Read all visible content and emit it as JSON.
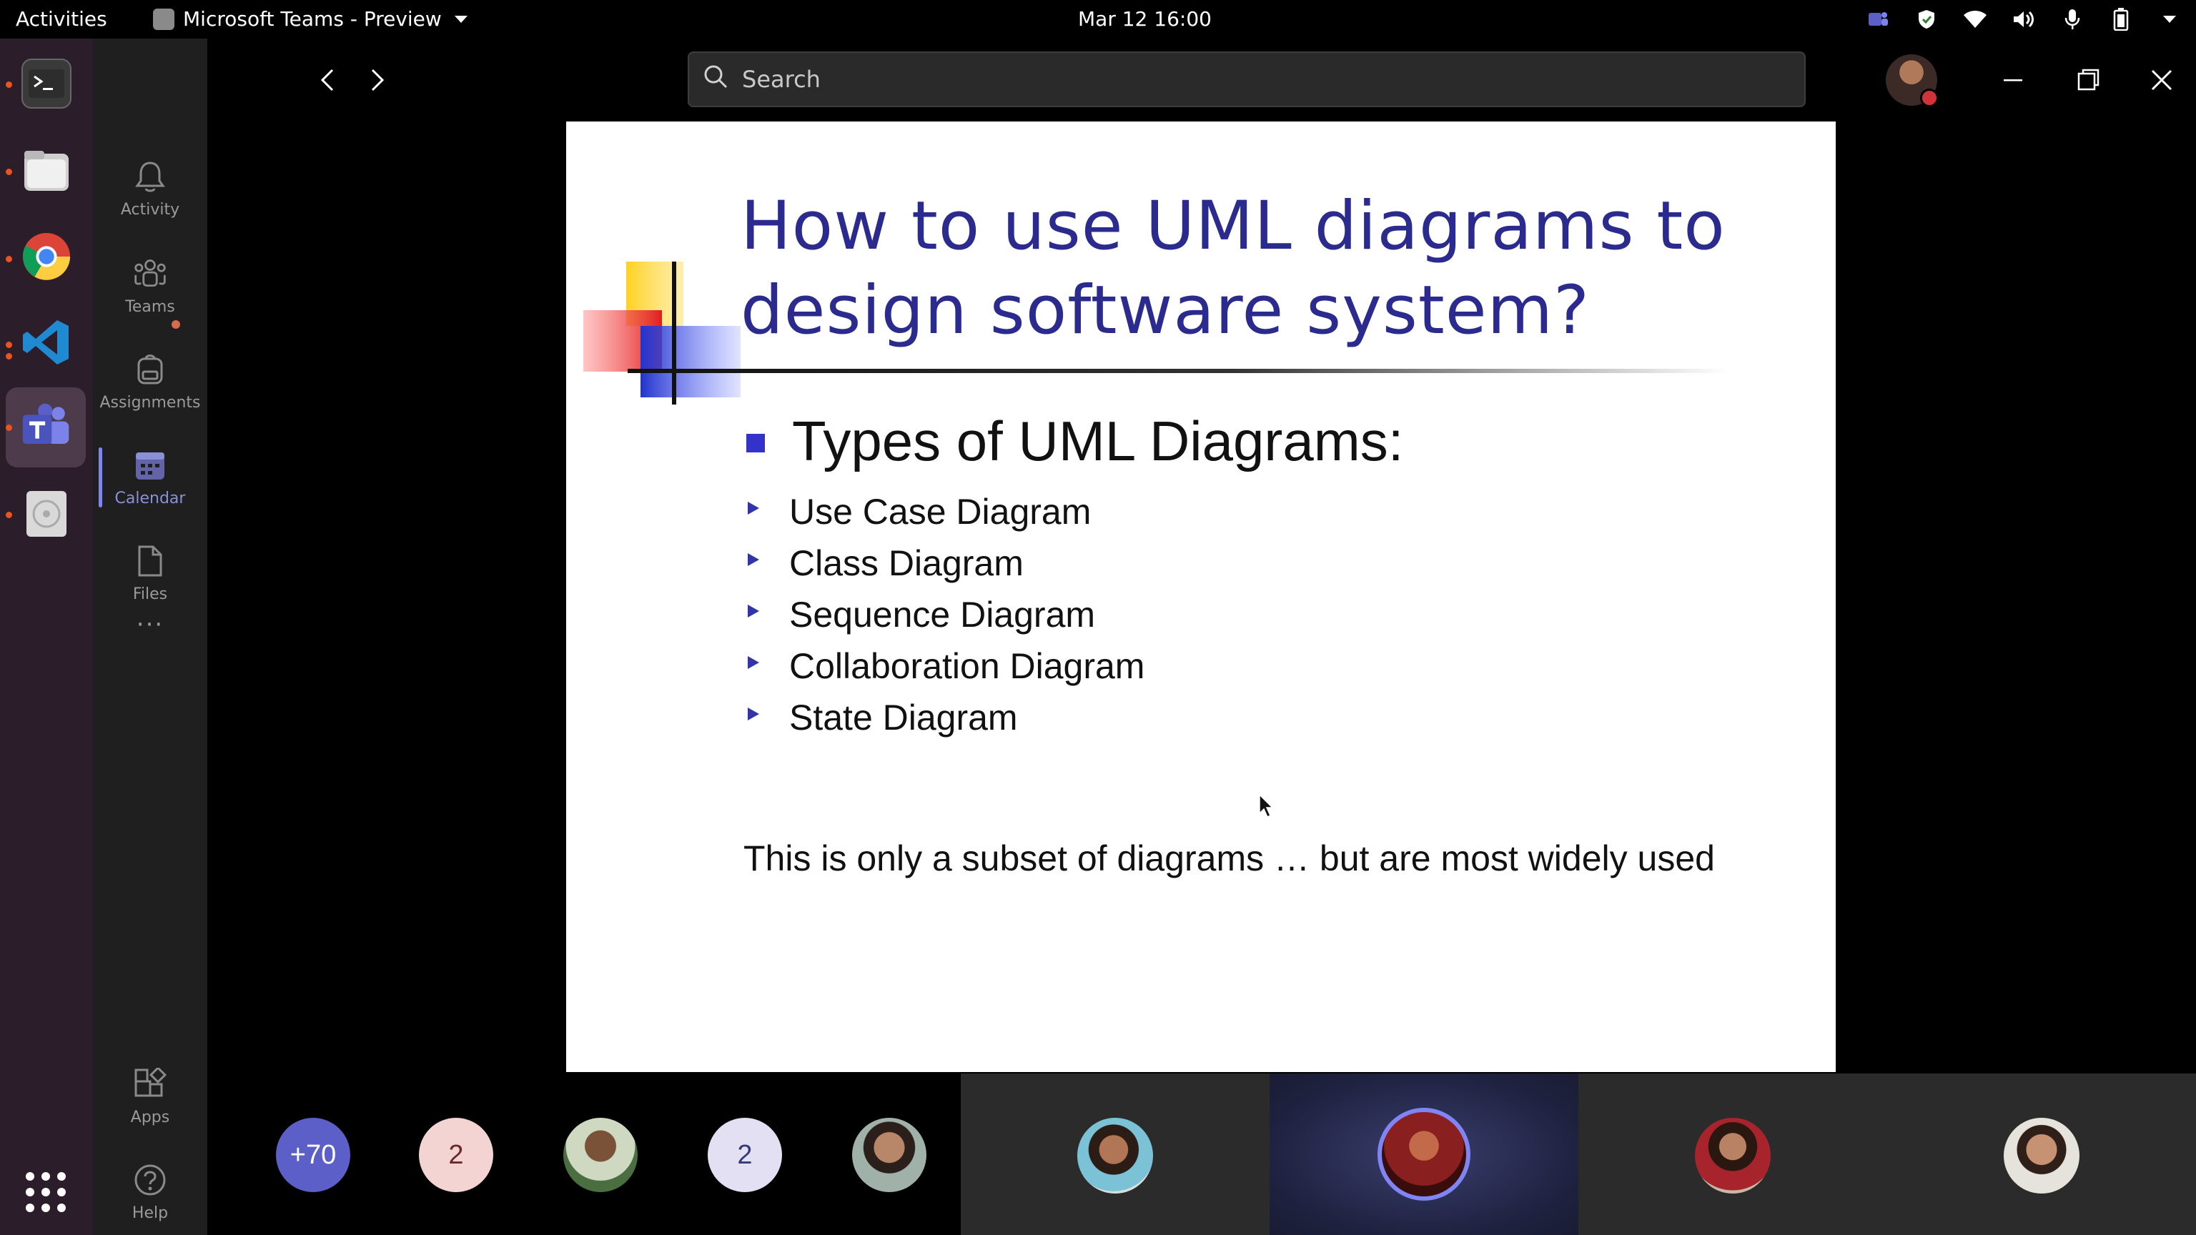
{
  "system": {
    "activities_label": "Activities",
    "app_menu_label": "Microsoft Teams - Preview",
    "clock": "Mar 12  16:00"
  },
  "teams_rail": {
    "items": [
      {
        "label": "Activity",
        "icon": "bell-icon"
      },
      {
        "label": "Teams",
        "icon": "teams-icon"
      },
      {
        "label": "Assignments",
        "icon": "backpack-icon"
      },
      {
        "label": "Calendar",
        "icon": "calendar-icon"
      },
      {
        "label": "Files",
        "icon": "file-icon"
      }
    ],
    "more_label": "···",
    "apps_label": "Apps",
    "help_label": "Help"
  },
  "header": {
    "search_placeholder": "Search"
  },
  "slide": {
    "title_line1": "How to use UML diagrams to",
    "title_line2": "design software system?",
    "heading": "Types of UML Diagrams:",
    "items": [
      "Use Case Diagram",
      "Class Diagram",
      "Sequence Diagram",
      "Collaboration Diagram",
      "State Diagram"
    ],
    "footnote": "This is only a subset of diagrams … but are most widely used"
  },
  "participants": {
    "overflow_count": "+70",
    "count_badge_a": "2",
    "count_badge_b": "2"
  },
  "colors": {
    "teams_accent": "#7f85f5",
    "slide_title": "#2b2b8f",
    "status_busy": "#d13438",
    "dock_bg": "#2c1d2a"
  }
}
